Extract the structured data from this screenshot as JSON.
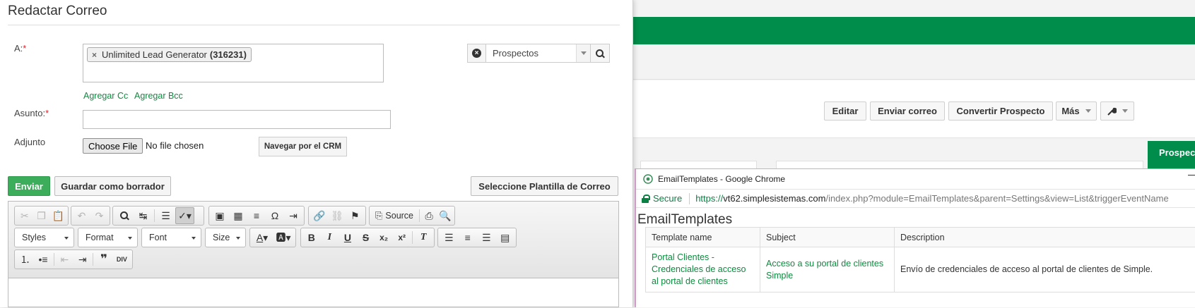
{
  "compose": {
    "title": "Redactar Correo",
    "to_label": "A:",
    "required_mark": "*",
    "recipient_chip": {
      "name": "Unlimited Lead Generator",
      "id": "(316231)",
      "remove": "×"
    },
    "add_cc": "Agregar Cc",
    "add_bcc": "Agregar Bcc",
    "subject_label": "Asunto:",
    "subject_value": "",
    "attachment_label": "Adjunto",
    "choose_file": "Choose File",
    "no_file": "No file chosen",
    "browse_crm": "Navegar por el CRM",
    "module_select": "Prospectos",
    "send": "Enviar",
    "save_draft": "Guardar como borrador",
    "select_template": "Seleccione Plantilla de Correo"
  },
  "editor": {
    "combos": [
      "Styles",
      "Format",
      "Font",
      "Size"
    ],
    "source_label": "Source",
    "icons_row1": [
      "cut-icon",
      "copy-icon",
      "paste-icon",
      "undo-icon",
      "redo-icon",
      "find-icon",
      "replace-icon",
      "select-all-icon",
      "spellcheck-icon",
      "image-icon",
      "table-icon",
      "horizontal-rule-icon",
      "special-char-icon",
      "page-break-icon",
      "link-icon",
      "unlink-icon",
      "anchor-icon",
      "source-icon",
      "templates-icon",
      "preview-icon"
    ],
    "icons_row2": [
      "text-color-icon",
      "bg-color-icon",
      "bold-icon",
      "italic-icon",
      "underline-icon",
      "strike-icon",
      "subscript-icon",
      "superscript-icon",
      "remove-format-icon",
      "align-left-icon",
      "align-center-icon",
      "align-right-icon",
      "justify-icon"
    ],
    "icons_row3": [
      "numbered-list-icon",
      "bulleted-list-icon",
      "outdent-icon",
      "indent-icon",
      "blockquote-icon",
      "div-icon"
    ]
  },
  "background": {
    "buttons": [
      "Editar",
      "Enviar correo",
      "Convertir Prospecto",
      "Más"
    ],
    "tab_label": "Prospecto"
  },
  "popup": {
    "window_title": "EmailTemplates - Google Chrome",
    "secure": "Secure",
    "url_proto": "https://",
    "url_host": "vt62.simplesistemas.com",
    "url_path": "/index.php?module=EmailTemplates&parent=Settings&view=List&triggerEventName",
    "heading": "EmailTemplates",
    "columns": [
      "Template name",
      "Subject",
      "Description"
    ],
    "rows": [
      {
        "name": "Portal Clientes - Credenciales de acceso al portal de clientes",
        "subject": "Acceso a su portal de clientes Simple",
        "description": "Envío de credenciales de acceso al portal de clientes de Simple."
      }
    ]
  },
  "colors": {
    "accent_green": "#008c4a",
    "send_green": "#3cad5a",
    "link_green": "#0e8a3f",
    "required_red": "#d9232e"
  }
}
